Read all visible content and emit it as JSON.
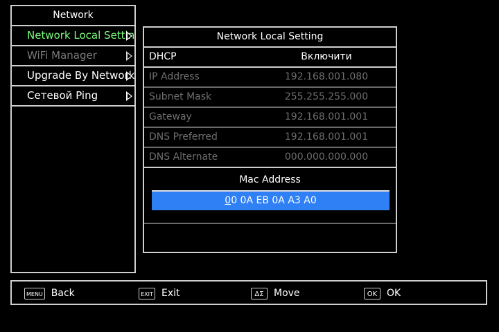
{
  "left_menu": {
    "title": "Network",
    "items": [
      {
        "label": "Network Local Setting",
        "state": "active"
      },
      {
        "label": "WiFi Manager",
        "state": "disabled"
      },
      {
        "label": "Upgrade By Network",
        "state": "normal"
      },
      {
        "label": "Сетевой Ping",
        "state": "normal"
      }
    ]
  },
  "settings": {
    "title": "Network Local Setting",
    "dhcp": {
      "label": "DHCP",
      "value": "Включити"
    },
    "rows": [
      {
        "label": "IP Address",
        "value": "192.168.001.080"
      },
      {
        "label": "Subnet Mask",
        "value": "255.255.255.000"
      },
      {
        "label": "Gateway",
        "value": "192.168.001.001"
      },
      {
        "label": "DNS Preferred",
        "value": "192.168.001.001"
      },
      {
        "label": "DNS Alternate",
        "value": "000.000.000.000"
      }
    ],
    "mac": {
      "title": "Mac Address",
      "cursor_char": "0",
      "value_rest": "0 0A EB 0A A3 A0"
    }
  },
  "bottom_bar": {
    "hints": [
      {
        "key": "MENU",
        "label": "Back"
      },
      {
        "key": "EXIT",
        "label": "Exit"
      },
      {
        "key": "ΔΣ",
        "label": "Move"
      },
      {
        "key": "OK",
        "label": "OK"
      }
    ]
  },
  "colors": {
    "highlight": "#2f7ff5",
    "active_text": "#7dff7d",
    "disabled_text": "#6e6e6e"
  }
}
